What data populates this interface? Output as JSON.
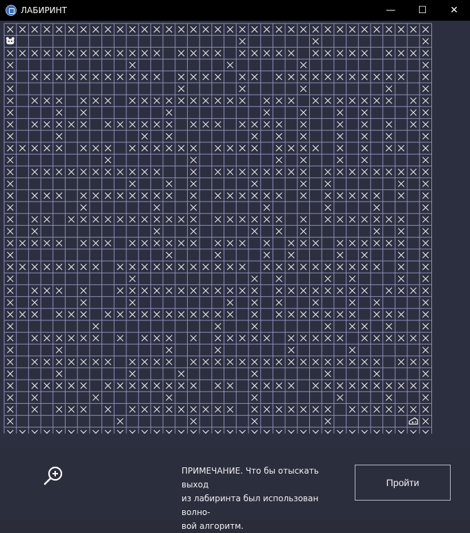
{
  "window": {
    "title": "ЛАБИРИНТ",
    "minimize_glyph": "—",
    "maximize_glyph": "☐",
    "close_glyph": "✕"
  },
  "maze": {
    "rows": [
      "XXXXXXXXXXXXXXXXXXXXXXXXXXXXXXXXXXX",
      "S..................X.....X........X",
      "XXXXXXXXXXXXX.XXXX.XXXXX.XXXXX.XXXX",
      "X.........X.......X.....X.........X",
      "X.XXXXXXXXXXX.XXXX.XX.XXXXXXXXXXX.X",
      "X.............X....X....X......X..X",
      "X.XXX.XXX.XXXXXXXXXX.XXX.XXXXXXX.XX",
      "X...X.X......X.......X..X..X.X...XX",
      "X.XXXXX.XXXXXX.XXX.XXXX.X..X.X.X.XX",
      "X...X......X.X......X.X.X..X.X.X..X",
      "XXXXX.XXX.XXXXXX.XXXX.XXXX.X.X.XX.X",
      "X.......X......X......X.X..X.X....X",
      "X.XXXXXXXXXXX..X.XXXXXXXX.XXXXXXXXX",
      "X.........X..X.X....X...X.X.....X.X",
      "X.XXX.XXXXXXXX.X.XXXXXX.X.XXXXX.X.X",
      "X.....X.....X..X.....X....X...X...X",
      "X.XX.XXXXXXXXXXX.XXXXXX.X.XXXXXXX.X",
      "X.X.........X..X....X.X.X.....X.X.X",
      "XXXXX.XXX.XXXXXX.XXX.X.XXX.XXXXXX.X",
      "X............X...X...X.X...X.X..X.X",
      "XXXXXXXX.XXXXXXXXXXX.XXXXXXXXXX.X.X",
      "X.........X.........X.X...X.X...X.X",
      "X.XXX.X..XXXXXXXXXXXX.XXXXXXXX.XXXX",
      "X.X...X...X.......X.X.X..X..X.X...X",
      "XXX.XXX.XXXXXXXXXXX.X.XXXXXXX.XXX.X",
      "X......X.........X..X.....X.XX.X..X",
      "X.XXXXXX.X.XXX.X.XXXXX.XXXXX.XXXXXX",
      "X...X........X...X.....X....X.....X",
      "X.XXXXXXX.XXXX.XXXXXXXXXXXXXXXX.XXX",
      "X...X.....X...X.....X.....X...X...X",
      "X.XXXXX.XXXXXXXX.XX.XXXX.XXXXXXXXXX",
      "X.X....X.....X......X......X...X..X",
      "X.X.XXX.X.XXXXXXXXX.XXXXXXX.XXXXXXX",
      "X........X.....X....X.....X......TX",
      "XXXXXXXXXXXXXXXXXXXXXXXXXXXXXXXXXXX"
    ],
    "start_icon": "hamster-icon",
    "target_icon": "cheese-icon",
    "cross_glyph": "×"
  },
  "note": {
    "lines": [
      "ПРИМЕЧАНИЕ. Что бы отыскать выход",
      "из лабиринта был использован волно-",
      "вой алгоритм."
    ]
  },
  "actions": {
    "zoom_icon": "zoom-in-icon",
    "run_label": "Пройти"
  },
  "colors": {
    "grid_line": "#8f8fb8",
    "background": "#2c2f3f",
    "cross": "#e8e8f0"
  }
}
